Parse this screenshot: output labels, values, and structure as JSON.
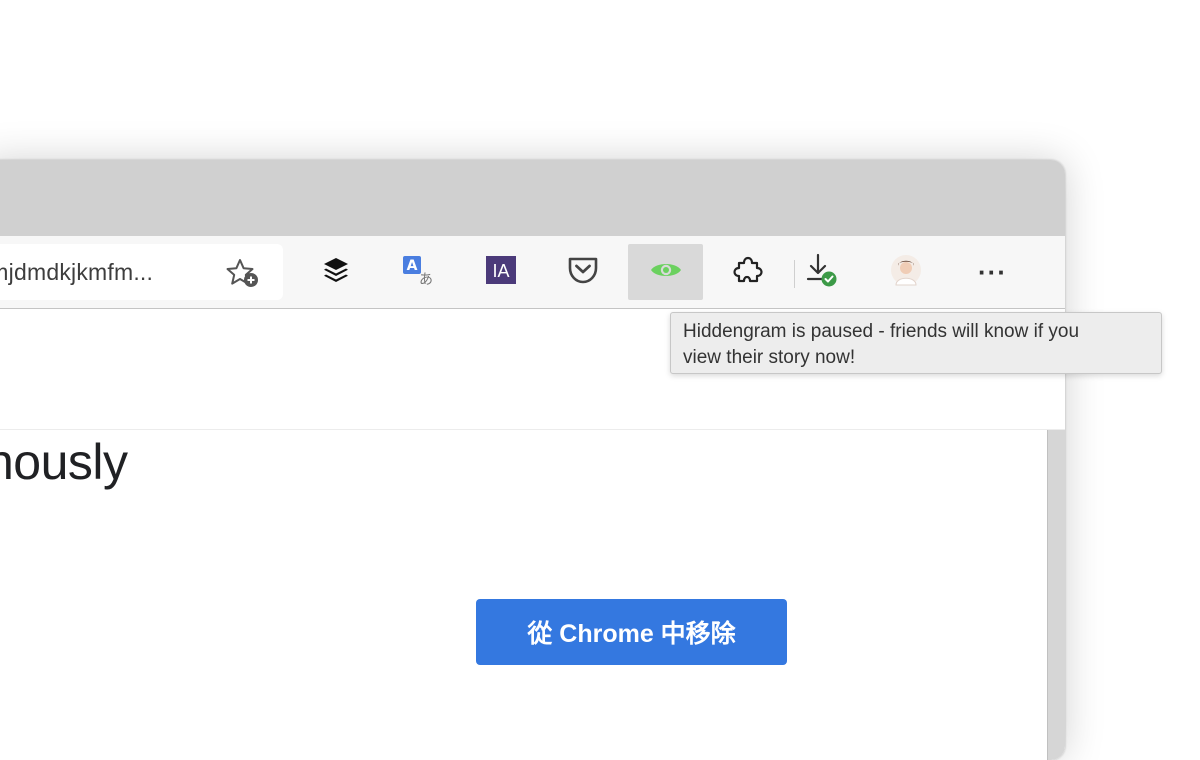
{
  "address_bar": {
    "url_text": "lmjdmdkjkmfm...",
    "favorite_icon": "star-plus-icon"
  },
  "toolbar": {
    "extensions": [
      {
        "name": "buffer",
        "icon": "stack-layers-icon"
      },
      {
        "name": "translate",
        "icon": "translate-icon",
        "glyph_a": "A",
        "glyph_b": "あ"
      },
      {
        "name": "internet-archive",
        "icon": "internet-archive-icon",
        "label": "IA"
      },
      {
        "name": "pocket",
        "icon": "pocket-icon"
      },
      {
        "name": "hiddengram",
        "icon": "eye-icon",
        "state": "paused",
        "accent": "#6bd15f"
      },
      {
        "name": "extensions",
        "icon": "puzzle-piece-icon"
      }
    ],
    "downloads_icon": "download-complete-icon",
    "profile_icon": "profile-avatar-icon",
    "menu_icon": "more-horizontal-icon",
    "menu_glyph": "···"
  },
  "tooltip": {
    "line1": "Hiddengram is paused - friends will know if you",
    "line2": "view their story now!"
  },
  "page": {
    "heading_fragment": "nously",
    "remove_button_label": "從 Chrome 中移除",
    "button_color": "#3478e0"
  }
}
